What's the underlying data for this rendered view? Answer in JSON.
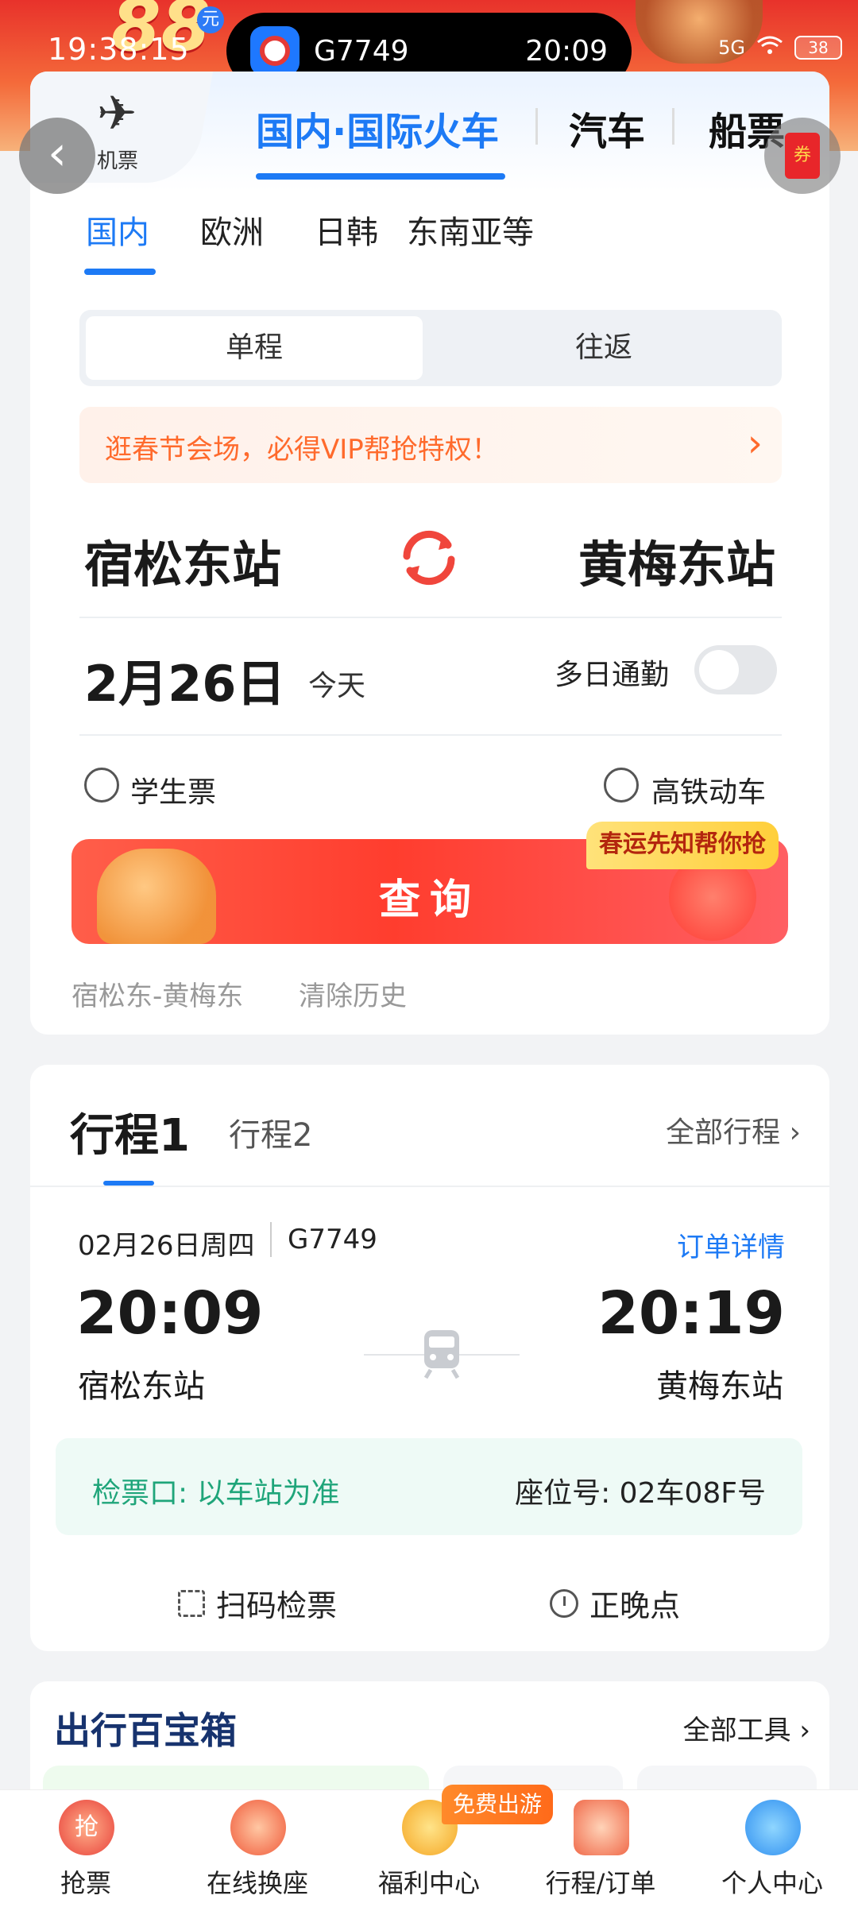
{
  "status_bar": {
    "time": "19:38:15",
    "signal": "5G",
    "battery": "38"
  },
  "dynamic_island": {
    "train_no": "G7749",
    "departure": "20:09"
  },
  "banner": {
    "amount": "88",
    "unit": "元"
  },
  "mode_tabs": {
    "plane": "机票",
    "train": "国内·国际火车",
    "bus": "汽车",
    "ship": "船票"
  },
  "coupon_icon_text": "券",
  "region_tabs": [
    "国内",
    "欧洲",
    "日韩",
    "东南亚等"
  ],
  "trip_type": {
    "one_way": "单程",
    "round_trip": "往返"
  },
  "promo": {
    "text": "逛春节会场，必得VIP帮抢特权！"
  },
  "search": {
    "from": "宿松东站",
    "to": "黄梅东站",
    "date": "2月26日",
    "date_note": "今天",
    "multi_day": "多日通勤",
    "student": "学生票",
    "high_speed": "高铁动车",
    "query": "查询",
    "query_badge": "春运先知帮你抢",
    "history_item": "宿松东-黄梅东",
    "clear_history": "清除历史"
  },
  "trip": {
    "tab1": "行程1",
    "tab2": "行程2",
    "all": "全部行程",
    "date": "02月26日周四",
    "train": "G7749",
    "order_detail": "订单详情",
    "dep_time": "20:09",
    "arr_time": "20:19",
    "dep_station": "宿松东站",
    "arr_station": "黄梅东站",
    "gate": "检票口: 以车站为准",
    "seat": "座位号: 02车08F号",
    "scan": "扫码检票",
    "on_time": "正晚点"
  },
  "toolbox": {
    "title": "出行百宝箱",
    "all": "全部工具"
  },
  "bottom_nav": {
    "items": [
      "抢票",
      "在线换座",
      "福利中心",
      "行程/订单",
      "个人中心"
    ],
    "free_badge": "免费出游",
    "grab_icon_text": "抢"
  },
  "colors": {
    "accent": "#1d7af5",
    "promo": "#ff6a2c",
    "gate": "#1fa57a",
    "query": "#ff3d2e"
  }
}
